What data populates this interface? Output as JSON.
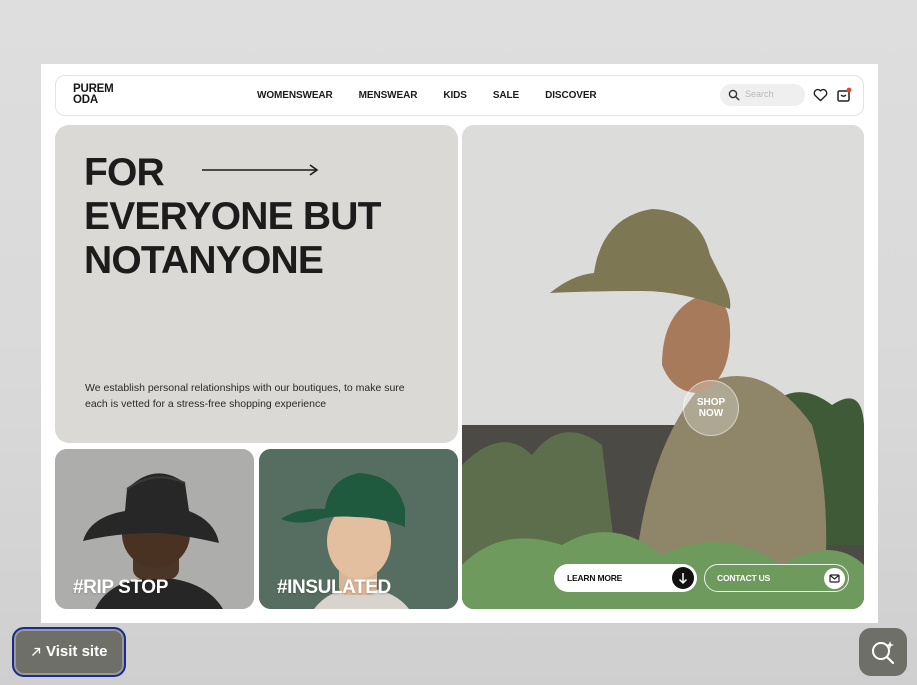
{
  "site": {
    "logo": "PUREM ODA",
    "nav": [
      "WOMENSWEAR",
      "MENSWEAR",
      "KIDS",
      "SALE",
      "DISCOVER"
    ],
    "search_placeholder": "Search",
    "icons": {
      "search": "search-icon",
      "favorite": "heart-icon",
      "cart": "shopping-bag-icon"
    }
  },
  "hero": {
    "headline_line1": "FOR",
    "headline_line2": "EVERYONE BUT",
    "headline_line3": "NOTANYONE",
    "description": "We establish personal relationships with our boutiques, to make sure each is vetted for a stress-free shopping experience"
  },
  "cards": [
    {
      "tag": "#RIP STOP",
      "color": "#a9a9a6"
    },
    {
      "tag": "#INSULATED",
      "color": "#556d60"
    }
  ],
  "photo": {
    "shop_now_line1": "SHOP",
    "shop_now_line2": "NOW",
    "learn_more": "LEARN MORE",
    "contact_us": "CONTACT US"
  },
  "controls": {
    "visit_site": "Visit site",
    "accent": "#1b2a8f"
  }
}
